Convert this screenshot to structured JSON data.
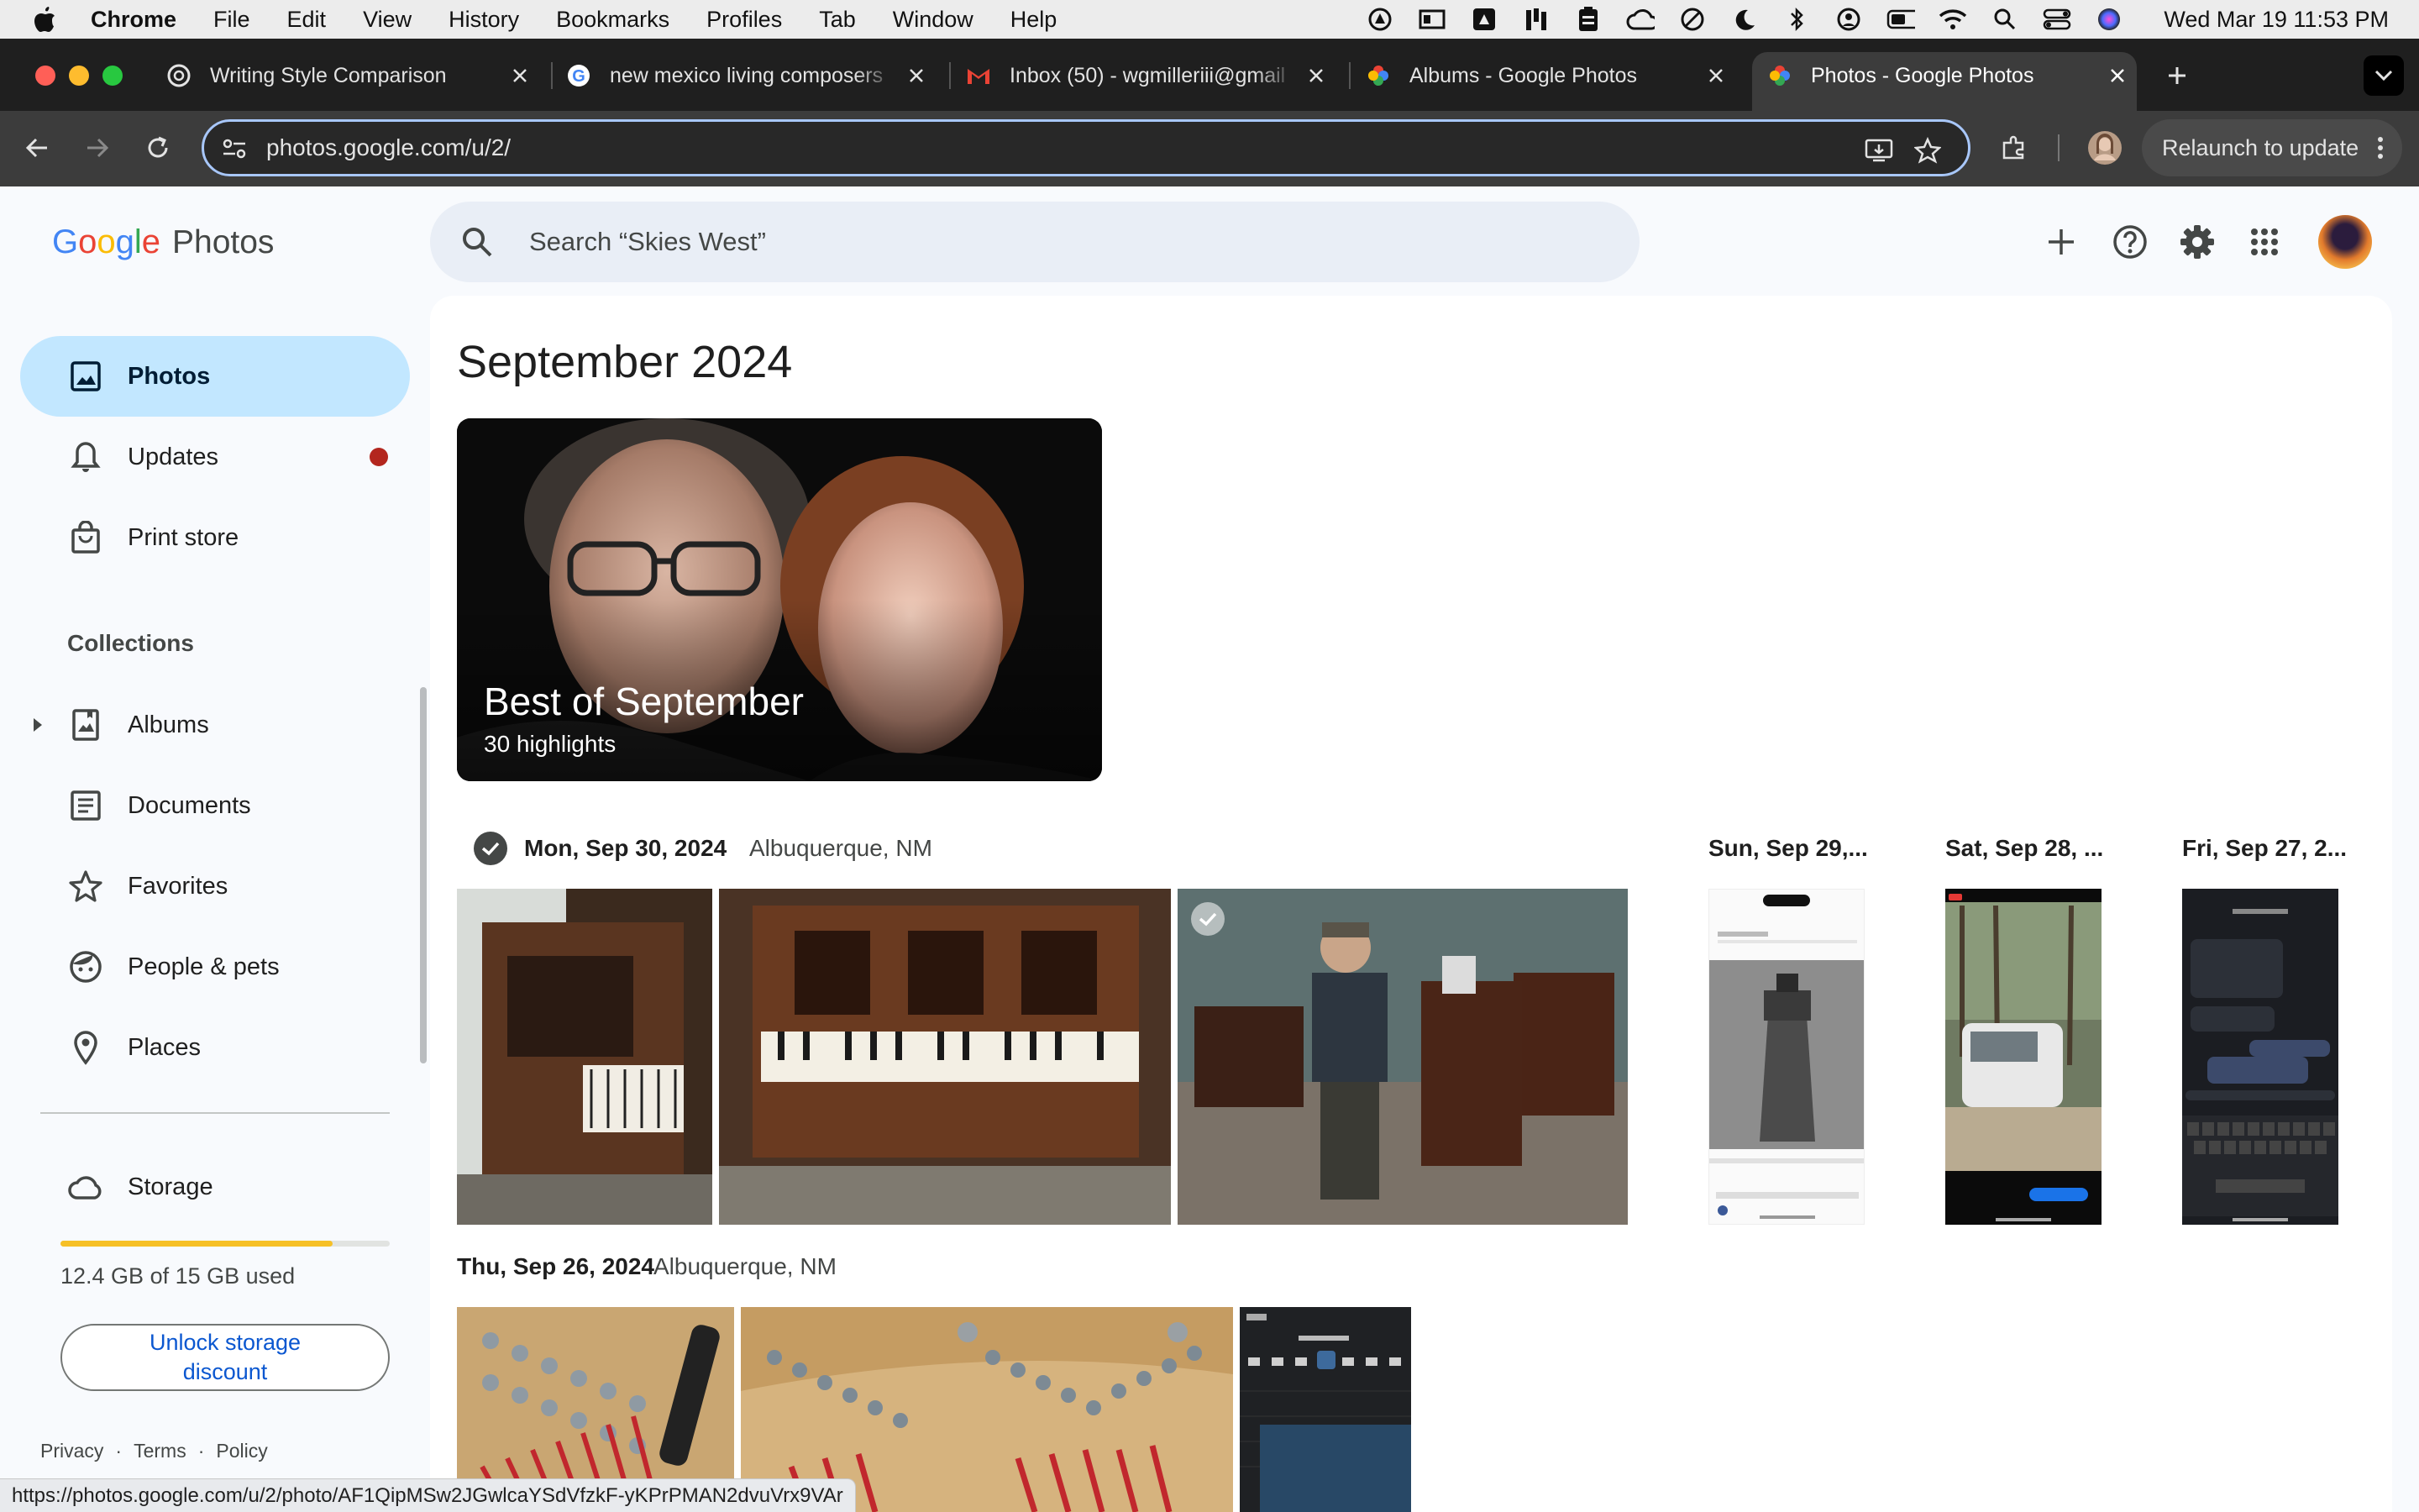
{
  "menubar": {
    "app_name": "Chrome",
    "items": [
      "File",
      "Edit",
      "View",
      "History",
      "Bookmarks",
      "Profiles",
      "Tab",
      "Window",
      "Help"
    ],
    "clock": "Wed Mar 19  11:53 PM"
  },
  "tabs": [
    {
      "title": "Writing Style Comparison",
      "favicon": "openai-icon"
    },
    {
      "title": "new mexico living composers",
      "favicon": "google-icon"
    },
    {
      "title": "Inbox (50) - wgmilleriii@gmail",
      "favicon": "gmail-icon"
    },
    {
      "title": "Albums - Google Photos",
      "favicon": "photos-icon"
    },
    {
      "title": "Photos - Google Photos",
      "favicon": "photos-icon",
      "active": true
    }
  ],
  "toolbar": {
    "url": "photos.google.com/u/2/",
    "relaunch_label": "Relaunch to update"
  },
  "header": {
    "logo_google": "Google",
    "logo_photos": "Photos",
    "search_placeholder": "Search “Skies West”"
  },
  "sidebar": {
    "items": [
      {
        "label": "Photos",
        "icon": "photo-icon",
        "active": true
      },
      {
        "label": "Updates",
        "icon": "bell-icon",
        "badge": true
      },
      {
        "label": "Print store",
        "icon": "shopping-bag-icon"
      }
    ],
    "collections_title": "Collections",
    "collections": [
      {
        "label": "Albums",
        "icon": "album-icon"
      },
      {
        "label": "Documents",
        "icon": "document-icon"
      },
      {
        "label": "Favorites",
        "icon": "star-icon"
      },
      {
        "label": "People & pets",
        "icon": "face-icon"
      },
      {
        "label": "Places",
        "icon": "location-pin-icon"
      }
    ],
    "storage": {
      "label": "Storage",
      "used_text": "12.4 GB of 15 GB used",
      "used_fraction": 0.827,
      "button": "Unlock storage discount"
    },
    "footer": [
      "Privacy",
      "Terms",
      "Policy"
    ]
  },
  "main": {
    "month": "September 2024",
    "highlight": {
      "title": "Best of September",
      "subtitle": "30 highlights"
    },
    "days": [
      {
        "date": "Mon, Sep 30, 2024",
        "location": "Albuquerque, NM"
      },
      {
        "date": "Sun, Sep 29,..."
      },
      {
        "date": "Sat, Sep 28, ..."
      },
      {
        "date": "Fri, Sep 27, 2..."
      },
      {
        "date": "Thu, Sep 26, 2024",
        "location": "Albuquerque, NM"
      }
    ]
  },
  "statusbar": {
    "url": "https://photos.google.com/u/2/photo/AF1QipMSw2JGwlcaYSdVfzkF-yKPrPMAN2dvuVrx9VAr"
  },
  "colors": {
    "accent_blue": "#0b57d0",
    "nav_active": "#c2e7ff",
    "badge_red": "#b3261e",
    "storage_yellow": "#f6c026"
  }
}
